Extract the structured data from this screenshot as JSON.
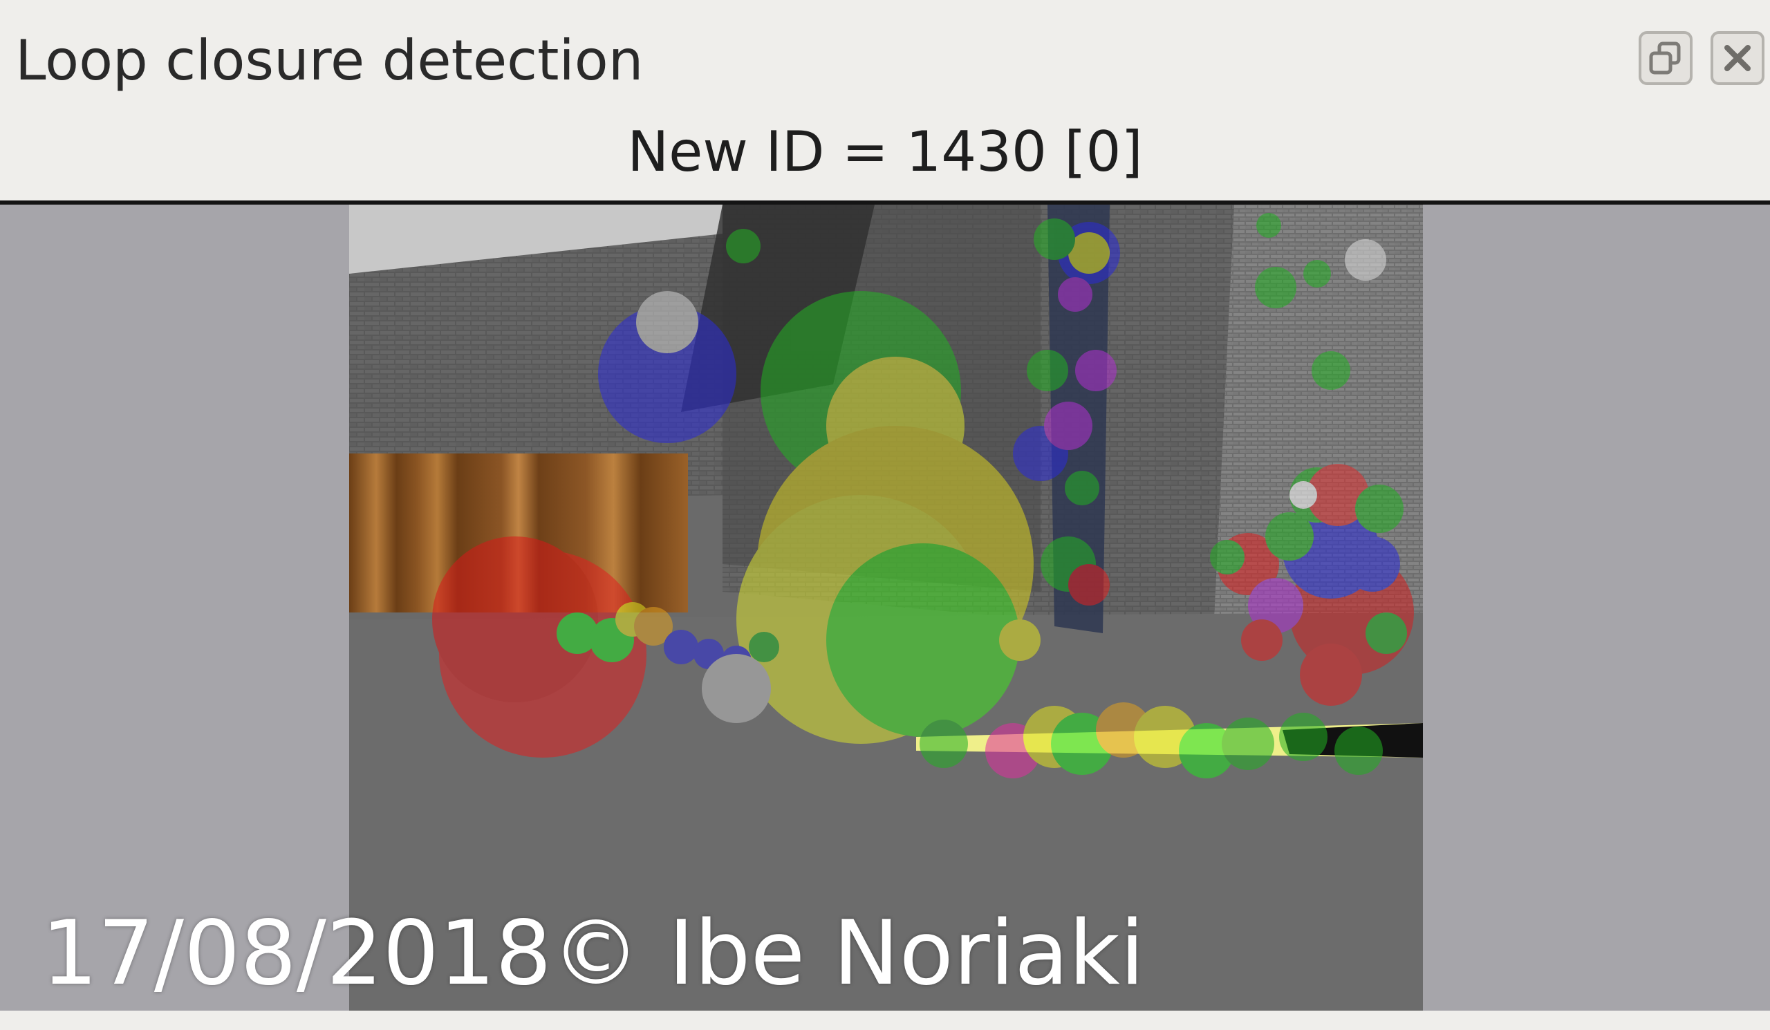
{
  "panel": {
    "title": "Loop closure detection",
    "subtitle": "New ID = 1430 [0]"
  },
  "window_controls": {
    "float_icon": "float-window-icon",
    "close_icon": "close-window-icon"
  },
  "watermark": "17/08/2018© Ibe Noriaki",
  "colors": {
    "panel_bg": "#efeeeb",
    "view_bg": "#a6a5aa",
    "divider": "#141414"
  }
}
